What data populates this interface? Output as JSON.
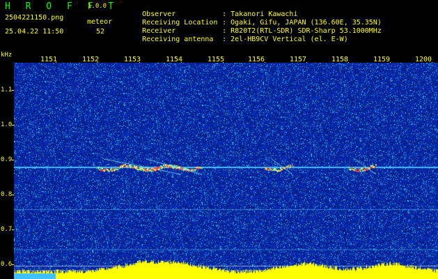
{
  "header": {
    "app_title": "H R O F F T",
    "app_version": "1.0.0",
    "file_name": "2504221150.png",
    "datetime": "25.04.22 11:50",
    "meteor_label": "meteor",
    "meteor_count": "52",
    "info": [
      {
        "key": "Observer",
        "value": ": Takanori Kawachi"
      },
      {
        "key": "Receiving Location",
        "value": ": Ogaki, Gifu, JAPAN (136.60E, 35.35N)"
      },
      {
        "key": "Receiver",
        "value": ": R820T2(RTL-SDR) SDR-Sharp 53.1000MHz"
      },
      {
        "key": "Receiving antenna",
        "value": ": 2el-HB9CV Vertical (el. E-W)"
      }
    ]
  },
  "axes": {
    "unit": "kHz",
    "y_ticks": [
      "1.1",
      "1.0",
      "0.9",
      "0.8",
      "0.7",
      "0.6"
    ],
    "x_ticks": [
      "1151",
      "1152",
      "1153",
      "1154",
      "1155",
      "1156",
      "1157",
      "1158",
      "1159",
      "1200"
    ]
  },
  "colors": {
    "background": "#000000",
    "label": "#ffff00",
    "title": "#00ff00",
    "noise_base": "#0a1a8c",
    "carrier_line": "#40c0ff",
    "histogram": "#ffff00"
  },
  "spectrogram": {
    "carrier_khz": 0.9,
    "y_range_khz": [
      0.58,
      1.2
    ],
    "meteor_bursts_minutes": [
      "1152",
      "1153",
      "1156",
      "1158"
    ]
  }
}
